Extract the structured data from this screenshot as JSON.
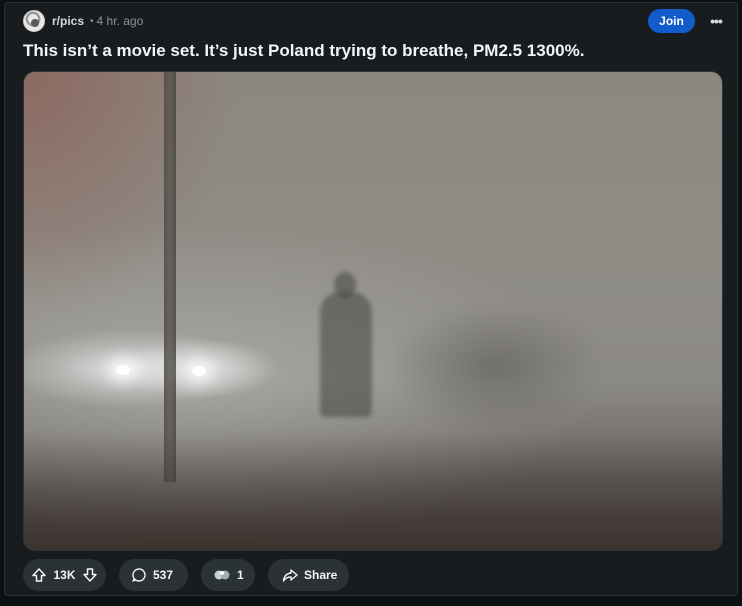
{
  "post": {
    "subreddit": "r/pics",
    "separator": "•",
    "time_ago": "4 hr. ago",
    "title": "This isn’t a movie set. It’s just Poland trying to breathe, PM2.5 1300%.",
    "join_label": "Join",
    "more_label": "•••"
  },
  "actions": {
    "upvotes": "13K",
    "comments": "537",
    "awards": "1",
    "share_label": "Share"
  },
  "icons": {
    "upvote": "arrow-up-icon",
    "downvote": "arrow-down-icon",
    "comment": "comment-bubble-icon",
    "award": "award-icon",
    "share": "share-arrow-icon"
  },
  "colors": {
    "background": "#0e1113",
    "card": "#181c1f",
    "join_button": "#115bca",
    "pill": "#2a3236",
    "text": "#f2f4f5",
    "muted": "#8a9499"
  }
}
